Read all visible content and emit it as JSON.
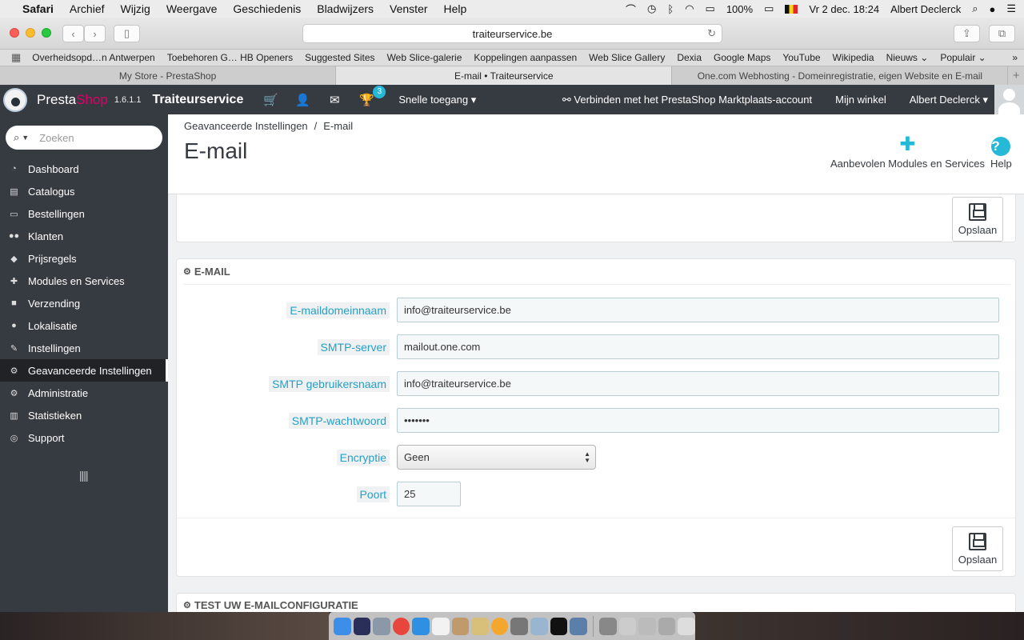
{
  "menubar": {
    "app": "Safari",
    "items": [
      "Archief",
      "Wijzig",
      "Weergave",
      "Geschiedenis",
      "Bladwijzers",
      "Venster",
      "Help"
    ],
    "battery": "100%",
    "datetime": "Vr 2 dec.  18:24",
    "user": "Albert Declerck"
  },
  "browser": {
    "url": "traiteurservice.be",
    "bookmarks": [
      "Overheidsopd…n Antwerpen",
      "Toebehoren G… HB Openers",
      "Suggested Sites",
      "Web Slice-galerie",
      "Koppelingen aanpassen",
      "Web Slice Gallery",
      "Dexia",
      "Google Maps",
      "YouTube",
      "Wikipedia",
      "Nieuws ⌄",
      "Populair ⌄"
    ],
    "bookmarks_more": "»",
    "tabs": [
      "My Store - PrestaShop",
      "E-mail • Traiteurservice",
      "One.com Webhosting - Domeinregistratie, eigen Website en E-mail"
    ],
    "new_tab": "+"
  },
  "header": {
    "brand_presta": "Presta",
    "brand_shop": "Shop",
    "version": "1.6.1.1",
    "shop_name": "Traiteurservice",
    "badge_count": "3",
    "quick_access": "Snelle toegang ▾",
    "marketplace": "Verbinden met het PrestaShop Marktplaats-account",
    "my_shop": "Mijn winkel",
    "employee": "Albert Declerck ▾"
  },
  "sidebar": {
    "search_placeholder": "Zoeken",
    "items": [
      {
        "label": "Dashboard",
        "icon": "dashboard-icon"
      },
      {
        "label": "Catalogus",
        "icon": "book-icon"
      },
      {
        "label": "Bestellingen",
        "icon": "credit-card-icon"
      },
      {
        "label": "Klanten",
        "icon": "users-icon"
      },
      {
        "label": "Prijsregels",
        "icon": "tags-icon"
      },
      {
        "label": "Modules en Services",
        "icon": "puzzle-icon"
      },
      {
        "label": "Verzending",
        "icon": "truck-icon"
      },
      {
        "label": "Lokalisatie",
        "icon": "globe-icon"
      },
      {
        "label": "Instellingen",
        "icon": "wrench-icon"
      },
      {
        "label": "Geavanceerde Instellingen",
        "icon": "cogs-icon"
      },
      {
        "label": "Administratie",
        "icon": "cog-icon"
      },
      {
        "label": "Statistieken",
        "icon": "bar-chart-icon"
      },
      {
        "label": "Support",
        "icon": "lifebuoy-icon"
      }
    ],
    "active_index": 9
  },
  "page": {
    "breadcrumb_parent": "Geavanceerde Instellingen",
    "breadcrumb_sep": "/",
    "breadcrumb_current": "E-mail",
    "title": "E-mail",
    "toolbar_modules": "Aanbevolen Modules en Services",
    "toolbar_help": "Help",
    "save_label": "Opslaan"
  },
  "email_panel": {
    "heading": "E-MAIL",
    "fields": [
      {
        "label": "E-maildomeinnaam",
        "value": "info@traiteurservice.be"
      },
      {
        "label": "SMTP-server",
        "value": "mailout.one.com"
      },
      {
        "label": "SMTP gebruikersnaam",
        "value": "info@traiteurservice.be"
      },
      {
        "label": "SMTP-wachtwoord",
        "value": "•••••••"
      },
      {
        "label": "Encryptie",
        "value": "Geen"
      },
      {
        "label": "Poort",
        "value": "25"
      }
    ]
  },
  "test_panel": {
    "heading": "TEST UW E-MAILCONFIGURATIE"
  },
  "colors": {
    "accent": "#25b9d7",
    "brand_pink": "#df0067",
    "header_bg": "#363a41"
  }
}
